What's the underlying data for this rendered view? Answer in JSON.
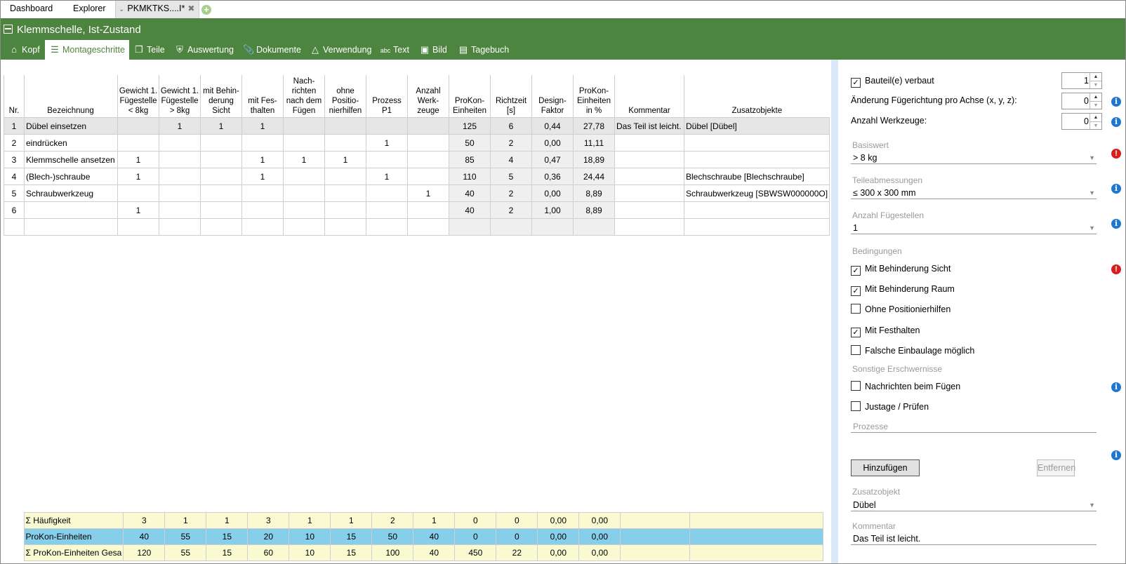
{
  "tabs": [
    "Dashboard",
    "Explorer",
    "PKMKTKS....I*"
  ],
  "header": {
    "title": "Klemmschelle, Ist-Zustand",
    "nav": [
      "Kopf",
      "Montageschritte",
      "Teile",
      "Auswertung",
      "Dokumente",
      "Verwendung",
      "Text",
      "Bild",
      "Tagebuch"
    ]
  },
  "grid": {
    "columns": [
      "Nr.",
      "Bezeichnung",
      "Gewicht 1. Fügestelle < 8kg",
      "Gewicht 1. Fügestelle > 8kg",
      "mit Behin-derung Sicht",
      "mit Fes-thalten",
      "Nach-richten nach dem Fügen",
      "ohne Positio-nierhilfen",
      "Prozess P1",
      "Anzahl Werk-zeuge",
      "ProKon-Einheiten",
      "Richtzeit [s]",
      "Design-Faktor",
      "ProKon-Einheiten in %",
      "Kommentar",
      "Zusatzobjekte"
    ],
    "rows": [
      [
        "1",
        "Dübel einsetzen",
        "",
        "1",
        "1",
        "1",
        "",
        "",
        "",
        "",
        "125",
        "6",
        "0,44",
        "27,78",
        "Das Teil ist leicht.",
        "Dübel [Dübel]"
      ],
      [
        "2",
        "eindrücken",
        "",
        "",
        "",
        "",
        "",
        "",
        "1",
        "",
        "50",
        "2",
        "0,00",
        "11,11",
        "",
        ""
      ],
      [
        "3",
        "Klemmschelle ansetzen",
        "1",
        "",
        "",
        "1",
        "1",
        "1",
        "",
        "",
        "85",
        "4",
        "0,47",
        "18,89",
        "",
        ""
      ],
      [
        "4",
        "(Blech-)schraube",
        "1",
        "",
        "",
        "1",
        "",
        "",
        "1",
        "",
        "110",
        "5",
        "0,36",
        "24,44",
        "",
        "Blechschraube [Blechschraube]"
      ],
      [
        "5",
        "Schraubwerkzeug",
        "",
        "",
        "",
        "",
        "",
        "",
        "",
        "1",
        "40",
        "2",
        "0,00",
        "8,89",
        "",
        "Schraubwerkzeug [SBWSW000000O]"
      ],
      [
        "6",
        "",
        "1",
        "",
        "",
        "",
        "",
        "",
        "",
        "",
        "40",
        "2",
        "1,00",
        "8,89",
        "",
        ""
      ],
      [
        "",
        "",
        "",
        "",
        "",
        "",
        "",
        "",
        "",
        "",
        "",
        "",
        "",
        "",
        "",
        ""
      ]
    ],
    "footer": [
      [
        "Σ Häufigkeit",
        "3",
        "1",
        "1",
        "3",
        "1",
        "1",
        "2",
        "1",
        "0",
        "0",
        "0,00",
        "0,00",
        "",
        ""
      ],
      [
        "ProKon-Einheiten",
        "40",
        "55",
        "15",
        "20",
        "10",
        "15",
        "50",
        "40",
        "0",
        "0",
        "0,00",
        "0,00",
        "",
        ""
      ],
      [
        "Σ ProKon-Einheiten Gesa",
        "120",
        "55",
        "15",
        "60",
        "10",
        "15",
        "100",
        "40",
        "450",
        "22",
        "0,00",
        "0,00",
        "",
        ""
      ]
    ]
  },
  "panel": {
    "bauteil_verbaut": {
      "label": "Bauteil(e) verbaut",
      "checked": true,
      "value": "1"
    },
    "aenderung": {
      "label": "Änderung Fügerichtung pro Achse (x, y, z):",
      "value": "0"
    },
    "anzahl_werkzeuge": {
      "label": "Anzahl Werkzeuge:",
      "value": "0"
    },
    "basiswert": {
      "label": "Basiswert",
      "value": "> 8 kg"
    },
    "teileabmessungen": {
      "label": "Teileabmessungen",
      "value": "≤ 300 x 300 mm"
    },
    "anzahl_fuegestellen": {
      "label": "Anzahl Fügestellen",
      "value": "1"
    },
    "bedingungen_label": "Bedingungen",
    "bedingungen": [
      {
        "label": "Mit Behinderung Sicht",
        "checked": true
      },
      {
        "label": "Mit Behinderung Raum",
        "checked": true
      },
      {
        "label": "Ohne Positionierhilfen",
        "checked": false
      },
      {
        "label": "Mit Festhalten",
        "checked": true
      },
      {
        "label": "Falsche Einbaulage möglich",
        "checked": false
      }
    ],
    "sonstige_label": "Sonstige Erschwernisse",
    "sonstige": [
      {
        "label": "Nachrichten beim Fügen",
        "checked": false
      },
      {
        "label": "Justage / Prüfen",
        "checked": false
      }
    ],
    "prozesse_label": "Prozesse",
    "hinzufuegen": "Hinzufügen",
    "entfernen": "Entfernen",
    "zusatzobjekt": {
      "label": "Zusatzobjekt",
      "value": "Dübel"
    },
    "kommentar": {
      "label": "Kommentar",
      "value": "Das Teil ist leicht."
    }
  }
}
